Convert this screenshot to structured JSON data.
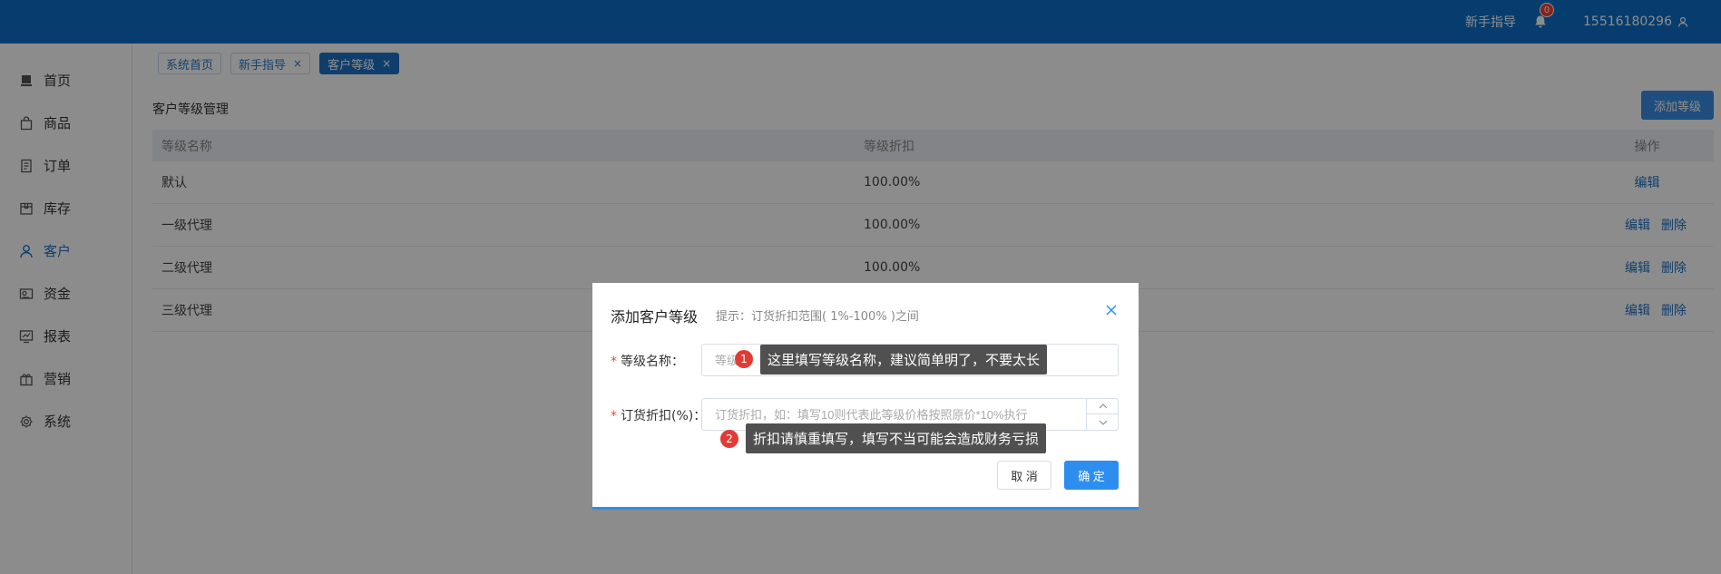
{
  "topbar": {
    "guide_label": "新手指导",
    "notification_count": "0",
    "username": "15516180296"
  },
  "sidebar": {
    "items": [
      {
        "label": "首页",
        "icon": "home-icon"
      },
      {
        "label": "商品",
        "icon": "bag-icon"
      },
      {
        "label": "订单",
        "icon": "order-icon"
      },
      {
        "label": "库存",
        "icon": "box-icon"
      },
      {
        "label": "客户",
        "icon": "user-icon"
      },
      {
        "label": "资金",
        "icon": "money-icon"
      },
      {
        "label": "报表",
        "icon": "chart-icon"
      },
      {
        "label": "营销",
        "icon": "gift-icon"
      },
      {
        "label": "系统",
        "icon": "gear-icon"
      }
    ],
    "active": "客户"
  },
  "tabs": [
    {
      "label": "系统首页",
      "closable": false
    },
    {
      "label": "新手指导",
      "closable": true
    },
    {
      "label": "客户等级",
      "closable": true,
      "active": true
    }
  ],
  "page": {
    "title": "客户等级管理",
    "add_button": "添加等级"
  },
  "table": {
    "headers": [
      "等级名称",
      "等级折扣",
      "操作"
    ],
    "rows": [
      {
        "name": "默认",
        "discount": "100.00%",
        "actions": [
          "编辑"
        ]
      },
      {
        "name": "一级代理",
        "discount": "100.00%",
        "actions": [
          "编辑",
          "删除"
        ]
      },
      {
        "name": "二级代理",
        "discount": "100.00%",
        "actions": [
          "编辑",
          "删除"
        ]
      },
      {
        "name": "三级代理",
        "discount": "100.00%",
        "actions": [
          "编辑",
          "删除"
        ]
      }
    ]
  },
  "modal": {
    "title": "添加客户等级",
    "hint": "提示：订货折扣范围( 1%-100% )之间",
    "name_label": "等级名称：",
    "name_placeholder": "等级",
    "discount_label": "订货折扣(%)：",
    "discount_placeholder": "订货折扣，如：填写10则代表此等级价格按照原价*10%执行",
    "cancel": "取 消",
    "ok": "确 定"
  },
  "tooltips": [
    {
      "num": "1",
      "text": "这里填写等级名称，建议简单明了，不要太长"
    },
    {
      "num": "2",
      "text": "折扣请慎重填写，填写不当可能会造成财务亏损"
    }
  ],
  "colors": {
    "topbar": "#0e6fc8",
    "accent": "#1d72c7",
    "primary_button": "#2d8ef0",
    "badge": "#f04134"
  }
}
